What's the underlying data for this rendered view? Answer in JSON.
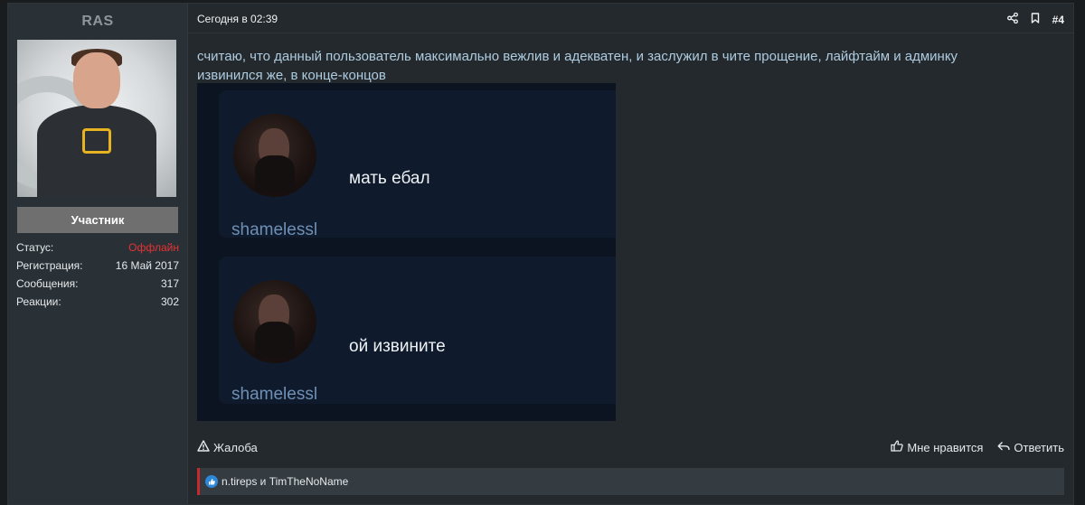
{
  "user": {
    "name": "RAS",
    "role": "Участник",
    "stats": [
      {
        "label": "Статус:",
        "value": "Оффлайн"
      },
      {
        "label": "Регистрация:",
        "value": "16 Май 2017"
      },
      {
        "label": "Сообщения:",
        "value": "317"
      },
      {
        "label": "Реакции:",
        "value": "302"
      }
    ]
  },
  "post": {
    "date": "Сегодня в 02:39",
    "number": "#4",
    "message": "считаю, что данный пользователь максимально вежлив и адекватен, и заслужил в чите прощение, лайфтайм и админку извинился же, в конце-концов",
    "image": {
      "cards": [
        {
          "text": "мать ебал",
          "author": "shamelessl"
        },
        {
          "text": "ой извините",
          "author": "shamelessl"
        }
      ]
    }
  },
  "actions": {
    "report": "Жалоба",
    "like": "Мне нравится",
    "reply": "Ответить"
  },
  "reactions": {
    "text": "n.tireps и TimTheNoName"
  },
  "colors": {
    "offline": "#e53232",
    "reaction_border": "#c32a2a",
    "like": "#2d88d8"
  }
}
